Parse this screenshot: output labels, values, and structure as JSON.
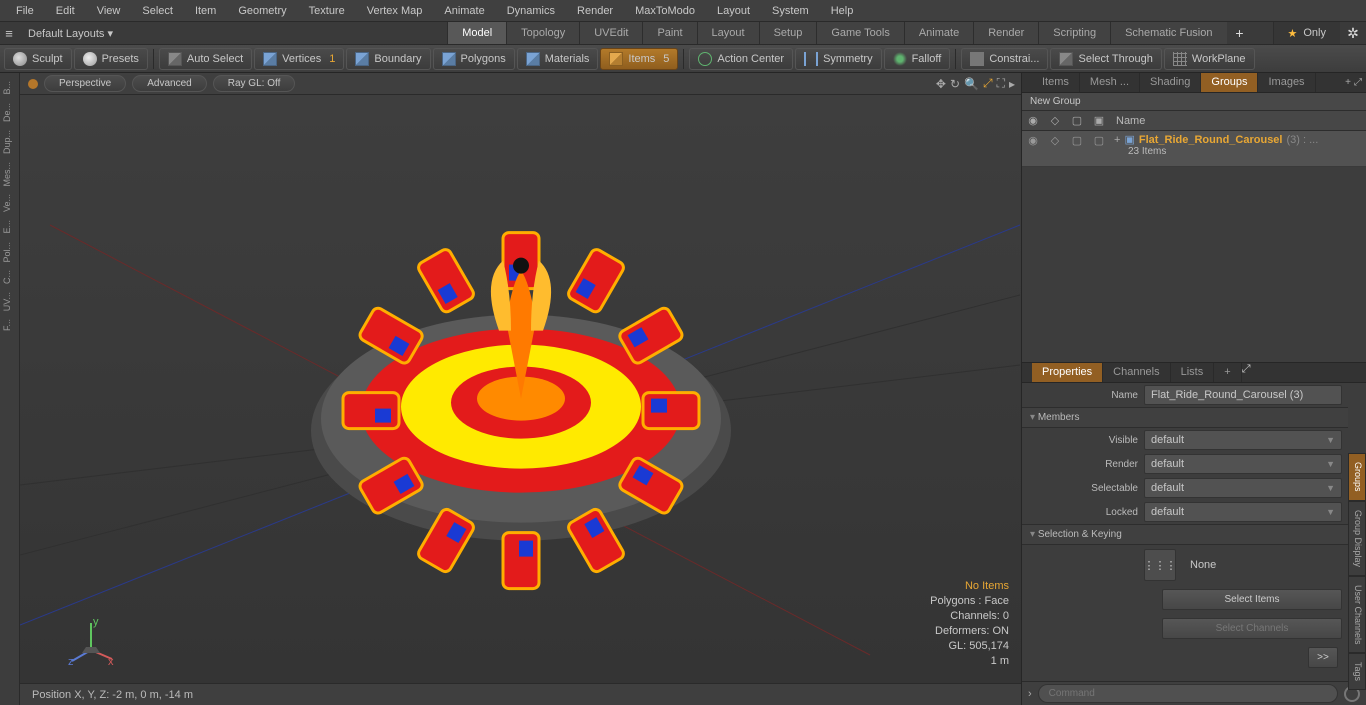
{
  "menu": [
    "File",
    "Edit",
    "View",
    "Select",
    "Item",
    "Geometry",
    "Texture",
    "Vertex Map",
    "Animate",
    "Dynamics",
    "Render",
    "MaxToModo",
    "Layout",
    "System",
    "Help"
  ],
  "layout": {
    "default": "Default Layouts ▾",
    "only": "Only"
  },
  "tabs": [
    "Model",
    "Topology",
    "UVEdit",
    "Paint",
    "Layout",
    "Setup",
    "Game Tools",
    "Animate",
    "Render",
    "Scripting",
    "Schematic Fusion"
  ],
  "tabs_active": 0,
  "toolbar": {
    "sculpt": "Sculpt",
    "presets": "Presets",
    "autoselect": "Auto Select",
    "vertices": "Vertices",
    "boundary": "Boundary",
    "polygons": "Polygons",
    "materials": "Materials",
    "items": "Items",
    "actioncenter": "Action Center",
    "symmetry": "Symmetry",
    "falloff": "Falloff",
    "constrain": "Constrai...",
    "selthrough": "Select Through",
    "workplane": "WorkPlane"
  },
  "viewport": {
    "persp": "Perspective",
    "adv": "Advanced",
    "ray": "Ray GL: Off",
    "noitems": "No Items",
    "polys": "Polygons : Face",
    "channels": "Channels: 0",
    "deformers": "Deformers: ON",
    "gl": "GL: 505,174",
    "unit": "1 m"
  },
  "statusbar": "Position X, Y, Z:    -2 m, 0 m, -14 m",
  "leftbar": [
    "B...",
    "De...",
    "Dup...",
    "Mes...",
    "Ve...",
    "E...",
    "Pol...",
    "C...",
    "UV...",
    "F..."
  ],
  "right_tabs": [
    "Items",
    "Mesh ...",
    "Shading",
    "Groups",
    "Images"
  ],
  "right_tabs_active": 3,
  "groups": {
    "new": "New Group",
    "hdr_name": "Name",
    "item_name": "Flat_Ride_Round_Carousel",
    "item_suffix": " (3) : ...",
    "item_count": "23 Items"
  },
  "prop_tabs": [
    "Properties",
    "Channels",
    "Lists"
  ],
  "prop_tabs_active": 0,
  "side_vtabs": [
    "Groups",
    "Group Display",
    "User Channels",
    "Tags"
  ],
  "props": {
    "name_lbl": "Name",
    "name_val": "Flat_Ride_Round_Carousel (3)",
    "members": "Members",
    "visible_lbl": "Visible",
    "visible_val": "default",
    "render_lbl": "Render",
    "render_val": "default",
    "selectable_lbl": "Selectable",
    "selectable_val": "default",
    "locked_lbl": "Locked",
    "locked_val": "default",
    "selkey": "Selection & Keying",
    "none": "None",
    "selitems": "Select Items",
    "selch": "Select Channels",
    "more": ">>"
  },
  "cmd_placeholder": "Command"
}
